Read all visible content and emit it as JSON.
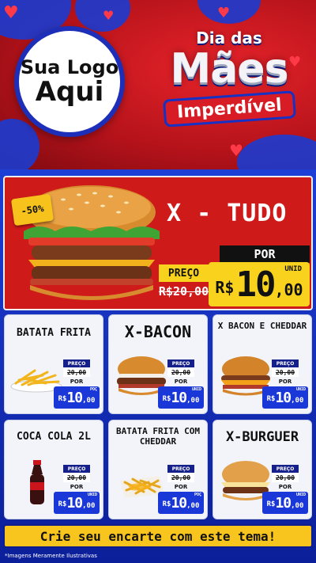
{
  "header": {
    "logo_line1": "Sua Logo",
    "logo_line2": "Aqui",
    "title_line1": "Dia das",
    "title_line2": "Mães",
    "title_line3": "Imperdível"
  },
  "featured": {
    "discount": "-50%",
    "name": "X - TUDO",
    "old_label": "PREÇO",
    "old_price": "R$20,00",
    "por_label": "POR",
    "currency": "R$",
    "price_int": "10",
    "price_dec": ",00",
    "unit": "UNID"
  },
  "cards": [
    {
      "title": "BATATA FRITA",
      "image": "fries",
      "preco_label": "PREÇO",
      "old_price": "20,00",
      "por_label": "POR",
      "currency": "R$",
      "price_int": "10",
      "price_dec": ",00",
      "unit": "POÇ"
    },
    {
      "title": "X-BACON",
      "image": "bacon-burger",
      "preco_label": "PREÇO",
      "old_price": "20,00",
      "por_label": "POR",
      "currency": "R$",
      "price_int": "10",
      "price_dec": ",00",
      "unit": "UNID"
    },
    {
      "title": "X BACON E CHEDDAR",
      "image": "cheddar-burger",
      "preco_label": "PREÇO",
      "old_price": "20,00",
      "por_label": "POR",
      "currency": "R$",
      "price_int": "10",
      "price_dec": ",00",
      "unit": "UNID"
    },
    {
      "title": "COCA COLA 2L",
      "image": "soda-bottle",
      "preco_label": "PREÇO",
      "old_price": "20,00",
      "por_label": "POR",
      "currency": "R$",
      "price_int": "10",
      "price_dec": ",00",
      "unit": "UNID"
    },
    {
      "title": "BATATA FRITA COM CHEDDAR",
      "image": "cheddar-fries",
      "preco_label": "PREÇO",
      "old_price": "20,00",
      "por_label": "POR",
      "currency": "R$",
      "price_int": "10",
      "price_dec": ",00",
      "unit": "POÇ"
    },
    {
      "title": "X-BURGUER",
      "image": "cheese-burger",
      "preco_label": "PREÇO",
      "old_price": "20,00",
      "por_label": "POR",
      "currency": "R$",
      "price_int": "10",
      "price_dec": ",00",
      "unit": "UNID"
    }
  ],
  "cta": "Crie seu encarte com este tema!",
  "footer_note": "*Imagens Meramente Ilustrativas",
  "colors": {
    "red": "#cf1a1a",
    "blue": "#1a37d8",
    "yellow": "#f9d21d",
    "navy": "#16208a"
  }
}
